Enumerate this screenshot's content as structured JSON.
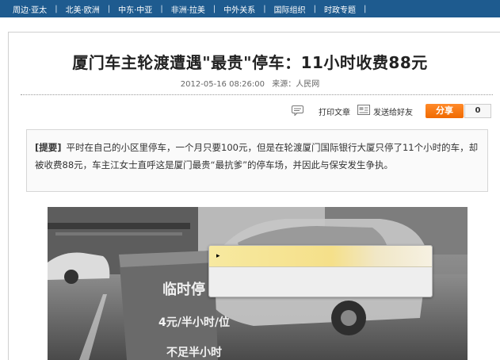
{
  "nav": {
    "items": [
      "周边·亚太",
      "北美·欧洲",
      "中东·中亚",
      "非洲·拉美",
      "中外关系",
      "国际组织",
      "时政专题"
    ],
    "separator": "|"
  },
  "article": {
    "title": "厦门车主轮渡遭遇\"最贵\"停车：11小时收费88元",
    "date": "2012-05-16 08:26:00",
    "source": "来源：人民网"
  },
  "toolbar": {
    "print_label": "打印文章",
    "send_label": "发送给好友",
    "share_label": "分享",
    "share_count": "0"
  },
  "summary": {
    "tag": "[提要]",
    "text": "平时在自己的小区里停车，一个月只要100元，但是在轮渡厦门国际银行大厦只停了11个小时的车，却被收费88元，车主江女士直呼这是厦门最贵“最抗爹”的停车场，并因此与保安发生争执。"
  },
  "photo": {
    "sign_line1": "临时停",
    "sign_line2": "4元/半小时/位",
    "sign_line3": "不足半小时"
  },
  "colors": {
    "nav_bg": "#1e5b8f",
    "share_orange": "#f07800",
    "popup_yellow": "#f5e08a"
  }
}
